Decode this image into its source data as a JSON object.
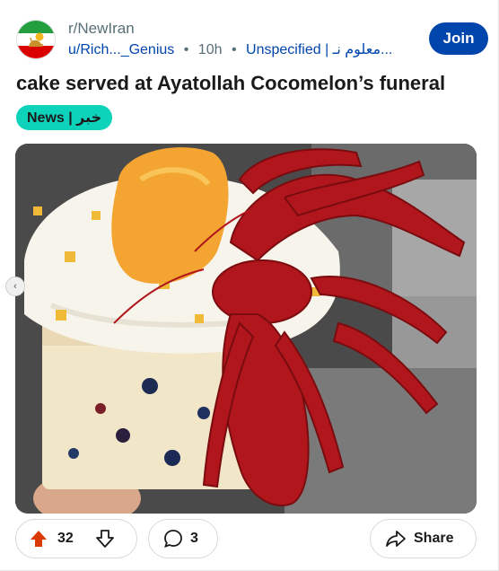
{
  "subreddit": {
    "name": "r/NewIran",
    "icon": "iran-flag-icon"
  },
  "post": {
    "author": "u/Rich..._Genius",
    "age": "10h",
    "separator": "•",
    "user_flair": "Unspecified | معلوم نـ...",
    "title": "cake served at Ayatollah Cocomelon’s funeral",
    "flair": "News | خبر"
  },
  "join_label": "Join",
  "actions": {
    "vote_count": "32",
    "comment_count": "3",
    "share_label": "Share"
  },
  "colors": {
    "accent": "#0045ac",
    "upvote": "#d93a00",
    "flair_bg": "#0dd3bb"
  },
  "icons": {
    "upvote": "upvote-arrow-icon",
    "downvote": "downvote-arrow-icon",
    "comment": "comment-bubble-icon",
    "share": "share-arrow-icon",
    "carousel": "carousel-nav-icon"
  }
}
